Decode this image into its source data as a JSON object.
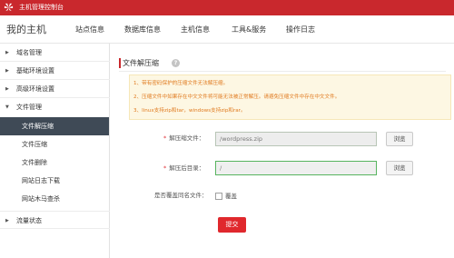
{
  "topbar": {
    "app_title": "主机管理控制台",
    "logo_icon": "huawei-logo",
    "color": "#c9282d"
  },
  "navbar": {
    "brand": "我的主机",
    "items": [
      "站点信息",
      "数据库信息",
      "主机信息",
      "工具&服务",
      "操作日志"
    ]
  },
  "sidebar": {
    "groups": [
      {
        "label": "域名管理",
        "expanded": false
      },
      {
        "label": "基础环境设置",
        "expanded": false
      },
      {
        "label": "高级环境设置",
        "expanded": false
      },
      {
        "label": "文件管理",
        "expanded": true
      },
      {
        "label": "流量状态",
        "expanded": false
      }
    ],
    "file_items": [
      {
        "label": "文件解压缩",
        "active": true
      },
      {
        "label": "文件压缩",
        "active": false
      },
      {
        "label": "文件删除",
        "active": false
      },
      {
        "label": "网站日志下载",
        "active": false
      },
      {
        "label": "网站木马查杀",
        "active": false
      }
    ],
    "active_color": "#3f4a56"
  },
  "main": {
    "title": "文件解压缩",
    "notices": [
      "1、带有密码保护的压缩文件无法解压缩。",
      "2、压缩文件中如果存在中文文件将可能无法被正常解压。请避免压缩文件中存在中文文件。",
      "3、linux支持zip和tar，windows支持zip和rar。"
    ],
    "form": {
      "source_label": "解压缩文件：",
      "source_value": "/wordpress.zip",
      "target_label": "解压后目录：",
      "target_value": "/",
      "browse_label": "浏览",
      "overwrite_question": "是否覆盖同名文件：",
      "overwrite_option": "覆盖",
      "overwrite_checked": false,
      "submit_label": "提交"
    }
  }
}
